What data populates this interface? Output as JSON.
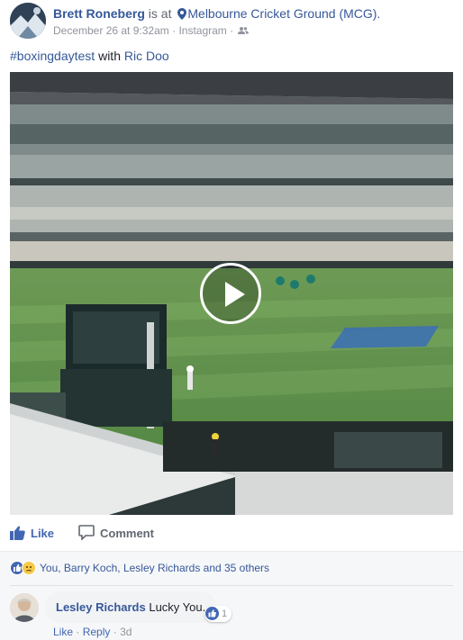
{
  "post": {
    "author": "Brett Roneberg",
    "is_at": "is at",
    "location": "Melbourne Cricket Ground (MCG).",
    "date": "December 26 at 9:32am",
    "source": "Instagram",
    "dot": "·",
    "hashtag": "#boxingdaytest",
    "with": "with",
    "tagged": "Ric Doo",
    "icons": {
      "pin": "location-pin-icon",
      "audience": "friends-audience-icon",
      "play": "play-icon"
    }
  },
  "actions": {
    "like_label": "Like",
    "comment_label": "Comment",
    "like_color": "#4267b2"
  },
  "reactions": {
    "text": "You, Barry Koch, Lesley Richards and 35 others",
    "types": [
      "like",
      "sad"
    ]
  },
  "comment": {
    "author": "Lesley Richards",
    "text": "Lucky You.",
    "reaction_count": "1",
    "like_link": "Like",
    "reply_link": "Reply",
    "dot": "·",
    "time": "3d"
  },
  "colors": {
    "link_blue": "#365899",
    "brand_blue": "#4267b2",
    "muted": "#90949c"
  }
}
